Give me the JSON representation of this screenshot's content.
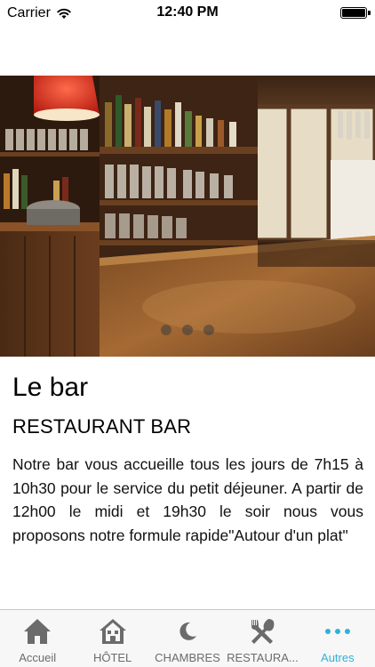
{
  "status_bar": {
    "carrier": "Carrier",
    "time": "12:40 PM",
    "wifi_icon": "wifi-icon",
    "battery_icon": "battery-icon",
    "battery_level": 1.0
  },
  "hero": {
    "image": "bar-photo",
    "pager": {
      "count": 3
    }
  },
  "content": {
    "title": "Le bar",
    "subtitle": "RESTAURANT BAR",
    "description": "Notre bar vous accueille tous les jours de 7h15 à 10h30 pour le service du petit déjeuner. A partir de 12h00 le midi et 19h30 le soir nous vous proposons notre formule rapide\"Autour d'un plat\""
  },
  "tabbar": {
    "active_color": "#2fb2d8",
    "inactive_color": "#6b6b6b",
    "items": [
      {
        "label": "Accueil",
        "icon": "home-icon",
        "active": false
      },
      {
        "label": "HÔTEL",
        "icon": "hotel-icon",
        "active": false
      },
      {
        "label": "CHAMBRES",
        "icon": "moon-icon",
        "active": false
      },
      {
        "label": "RESTAURA...",
        "icon": "utensils-icon",
        "active": false
      },
      {
        "label": "Autres",
        "icon": "more-icon",
        "active": true
      }
    ]
  }
}
